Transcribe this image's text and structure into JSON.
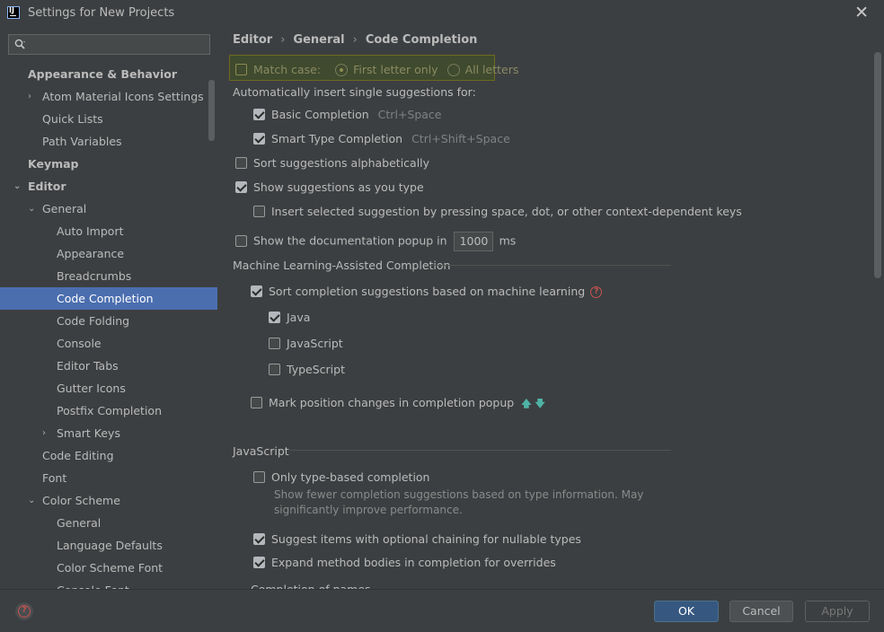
{
  "window": {
    "title": "Settings for New Projects",
    "close": "✕"
  },
  "search": {
    "placeholder": ""
  },
  "tree": [
    {
      "label": "Appearance & Behavior",
      "level": 0,
      "bold": true,
      "arrow": ""
    },
    {
      "label": "Atom Material Icons Settings",
      "level": 1,
      "bold": false,
      "arrow": "›"
    },
    {
      "label": "Quick Lists",
      "level": 1,
      "bold": false,
      "arrow": ""
    },
    {
      "label": "Path Variables",
      "level": 1,
      "bold": false,
      "arrow": ""
    },
    {
      "label": "Keymap",
      "level": 0,
      "bold": true,
      "arrow": ""
    },
    {
      "label": "Editor",
      "level": 0,
      "bold": true,
      "arrow": "⌄"
    },
    {
      "label": "General",
      "level": 1,
      "bold": false,
      "arrow": "⌄"
    },
    {
      "label": "Auto Import",
      "level": 2,
      "bold": false,
      "arrow": ""
    },
    {
      "label": "Appearance",
      "level": 2,
      "bold": false,
      "arrow": ""
    },
    {
      "label": "Breadcrumbs",
      "level": 2,
      "bold": false,
      "arrow": ""
    },
    {
      "label": "Code Completion",
      "level": 2,
      "bold": false,
      "arrow": "",
      "selected": true
    },
    {
      "label": "Code Folding",
      "level": 2,
      "bold": false,
      "arrow": ""
    },
    {
      "label": "Console",
      "level": 2,
      "bold": false,
      "arrow": ""
    },
    {
      "label": "Editor Tabs",
      "level": 2,
      "bold": false,
      "arrow": ""
    },
    {
      "label": "Gutter Icons",
      "level": 2,
      "bold": false,
      "arrow": ""
    },
    {
      "label": "Postfix Completion",
      "level": 2,
      "bold": false,
      "arrow": ""
    },
    {
      "label": "Smart Keys",
      "level": 2,
      "bold": false,
      "arrow": "›"
    },
    {
      "label": "Code Editing",
      "level": 1,
      "bold": false,
      "arrow": ""
    },
    {
      "label": "Font",
      "level": 1,
      "bold": false,
      "arrow": ""
    },
    {
      "label": "Color Scheme",
      "level": 1,
      "bold": false,
      "arrow": "⌄"
    },
    {
      "label": "General",
      "level": 2,
      "bold": false,
      "arrow": ""
    },
    {
      "label": "Language Defaults",
      "level": 2,
      "bold": false,
      "arrow": ""
    },
    {
      "label": "Color Scheme Font",
      "level": 2,
      "bold": false,
      "arrow": ""
    },
    {
      "label": "Console Font",
      "level": 2,
      "bold": false,
      "arrow": ""
    }
  ],
  "breadcrumb": {
    "part1": "Editor",
    "part2": "General",
    "part3": "Code Completion",
    "sep": "›"
  },
  "options": {
    "match_case": "Match case:",
    "first_letter": "First letter only",
    "all_letters": "All letters",
    "auto_insert": "Automatically insert single suggestions for:",
    "basic_completion": "Basic Completion",
    "basic_shortcut": "Ctrl+Space",
    "smart_type": "Smart Type Completion",
    "smart_shortcut": "Ctrl+Shift+Space",
    "sort_alpha": "Sort suggestions alphabetically",
    "show_as_type": "Show suggestions as you type",
    "insert_selected": "Insert selected suggestion by pressing space, dot, or other context-dependent keys",
    "show_doc": "Show the documentation popup in",
    "doc_ms_value": "1000",
    "doc_ms_unit": "ms"
  },
  "ml": {
    "title": "Machine Learning-Assisted Completion",
    "sort_ml": "Sort completion suggestions based on machine learning",
    "help": "?",
    "java": "Java",
    "javascript": "JavaScript",
    "typescript": "TypeScript",
    "mark_position": "Mark position changes in completion popup",
    "up_arrow": "🡅",
    "down_arrow": "🡇"
  },
  "js": {
    "title": "JavaScript",
    "type_based": "Only type-based completion",
    "type_based_desc1": "Show fewer completion suggestions based on type information. May",
    "type_based_desc2": "significantly improve performance.",
    "optional_chaining": "Suggest items with optional chaining for nullable types",
    "expand_method": "Expand method bodies in completion for overrides",
    "completion_of_names": "Completion of names"
  },
  "buttons": {
    "ok": "OK",
    "cancel": "Cancel",
    "apply": "Apply",
    "help": "?"
  }
}
